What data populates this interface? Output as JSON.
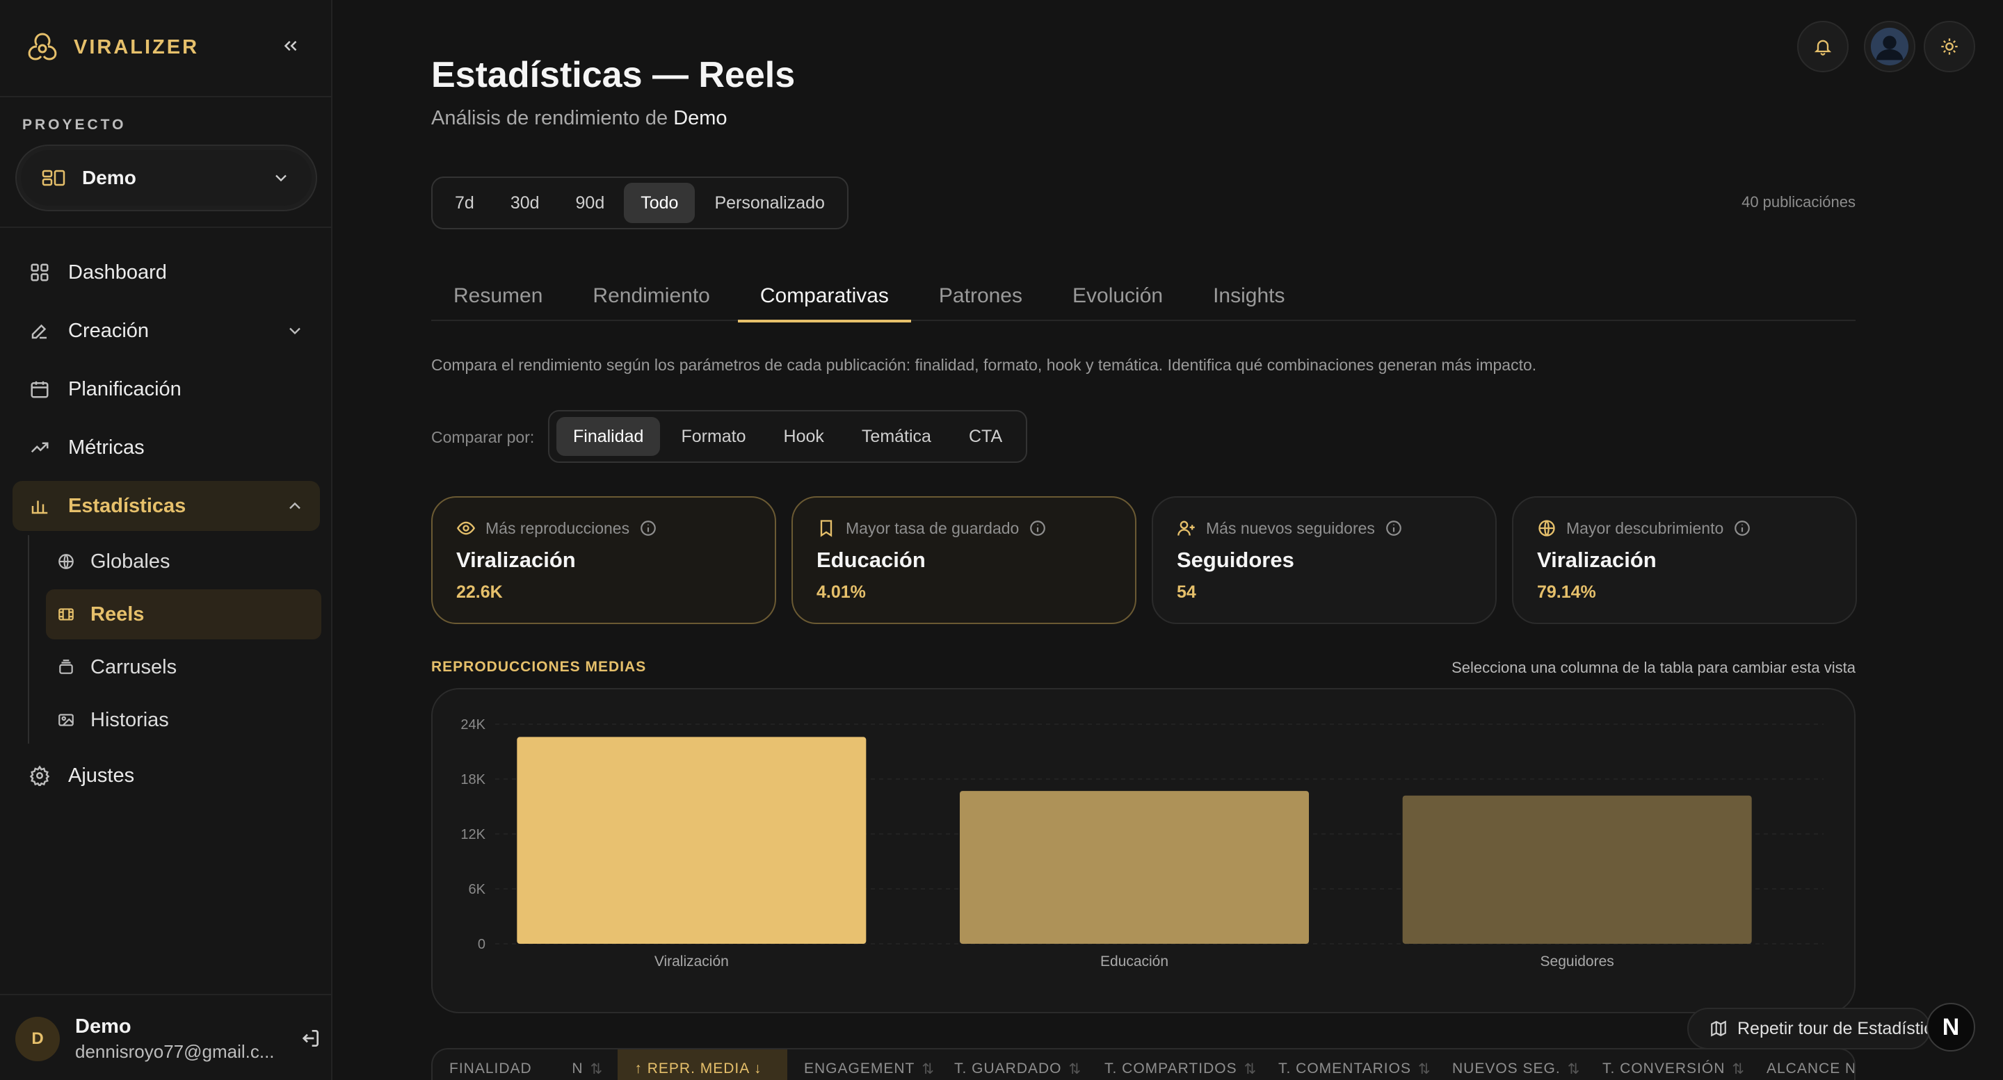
{
  "app": {
    "brand": "VIRALIZER"
  },
  "sidebar": {
    "project_label": "PROYECTO",
    "project_value": "Demo",
    "nav": [
      {
        "label": "Dashboard",
        "icon": "grid-icon"
      },
      {
        "label": "Creación",
        "icon": "edit-icon"
      },
      {
        "label": "Planificación",
        "icon": "calendar-icon"
      },
      {
        "label": "Métricas",
        "icon": "trending-up-icon"
      },
      {
        "label": "Estadísticas",
        "icon": "bar-chart-icon"
      }
    ],
    "sub": [
      {
        "label": "Globales",
        "icon": "globe-icon"
      },
      {
        "label": "Reels",
        "icon": "film-icon"
      },
      {
        "label": "Carrusels",
        "icon": "layers-icon"
      },
      {
        "label": "Historias",
        "icon": "image-icon"
      }
    ],
    "settings": {
      "label": "Ajustes",
      "icon": "settings-icon"
    },
    "user": {
      "initial": "D",
      "name": "Demo",
      "email": "dennisroyo77@gmail.c..."
    }
  },
  "header": {
    "title": "Estadísticas — Reels",
    "subtitle_prefix": "Análisis de rendimiento de ",
    "subtitle_project": "Demo",
    "pub_count": "40 publicaciónes"
  },
  "ranges": [
    "7d",
    "30d",
    "90d",
    "Todo",
    "Personalizado"
  ],
  "selected_range": "Todo",
  "tabs": [
    "Resumen",
    "Rendimiento",
    "Comparativas",
    "Patrones",
    "Evolución",
    "Insights"
  ],
  "selected_tab": "Comparativas",
  "description": "Compara el rendimiento según los parámetros de cada publicación: finalidad, formato, hook y temática. Identifica qué combinaciones generan más impacto.",
  "compare": {
    "label": "Comparar por:",
    "options": [
      "Finalidad",
      "Formato",
      "Hook",
      "Temática",
      "CTA"
    ],
    "selected": "Finalidad"
  },
  "cards": [
    {
      "label": "Más reproducciones",
      "icon": "eye-icon",
      "value": "Viralización",
      "number": "22.6K"
    },
    {
      "label": "Mayor tasa de guardado",
      "icon": "bookmark-icon",
      "value": "Educación",
      "number": "4.01%"
    },
    {
      "label": "Más nuevos seguidores",
      "icon": "user-plus-icon",
      "value": "Seguidores",
      "number": "54"
    },
    {
      "label": "Mayor descubrimiento",
      "icon": "globe-icon",
      "value": "Viralización",
      "number": "79.14%"
    }
  ],
  "chart_section": {
    "label": "REPRODUCCIONES MEDIAS",
    "hint": "Selecciona una columna de la tabla para cambiar esta vista"
  },
  "chart_data": {
    "type": "bar",
    "categories": [
      "Viralización",
      "Educación",
      "Seguidores"
    ],
    "values": [
      22600,
      16700,
      16200
    ],
    "y_ticks": [
      "0",
      "6K",
      "12K",
      "18K",
      "24K"
    ],
    "ylim": [
      0,
      24000
    ],
    "grid": true,
    "colors": [
      "#e8c170",
      "#ae9258",
      "#6c5c3a"
    ]
  },
  "tour": {
    "label": "Repetir tour de Estadísticas"
  },
  "table": {
    "columns": [
      "FINALIDAD",
      "N",
      "↑ REPR. MEDIA ↓",
      "ENGAGEMENT",
      "T. GUARDADO",
      "T. COMPARTIDOS",
      "T. COMENTARIOS",
      "NUEVOS SEG.",
      "T. CONVERSIÓN",
      "ALCANCE NO S"
    ],
    "selected": 2
  },
  "colors": {
    "accent": "#e6c06b",
    "bg": "#141414"
  }
}
